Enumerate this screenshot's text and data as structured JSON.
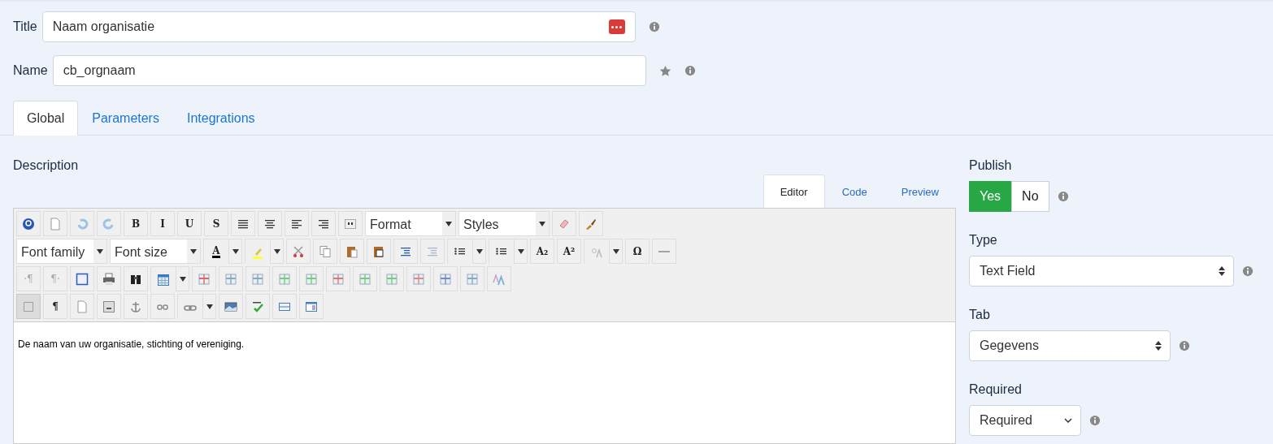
{
  "fields": [
    {
      "label": "Title",
      "value": "Naam organisatie",
      "addon": true,
      "star": false
    },
    {
      "label": "Name",
      "value": "cb_orgnaam",
      "addon": false,
      "star": true
    }
  ],
  "tabs": [
    {
      "label": "Global",
      "selected": true
    },
    {
      "label": "Parameters",
      "selected": false
    },
    {
      "label": "Integrations",
      "selected": false
    }
  ],
  "description": {
    "label": "Description",
    "editor_tabs": [
      {
        "label": "Editor",
        "selected": true
      },
      {
        "label": "Code",
        "selected": false
      },
      {
        "label": "Preview",
        "selected": false
      }
    ],
    "toolbar": [
      [
        {
          "kind": "button",
          "pressed": false
        },
        {
          "kind": "button",
          "pressed": false
        },
        {
          "kind": "button",
          "pressed": false
        },
        {
          "kind": "button",
          "pressed": false
        },
        {
          "kind": "button",
          "label": "B",
          "pressed": false
        },
        {
          "kind": "button",
          "label": "I",
          "pressed": false
        },
        {
          "kind": "button",
          "label": "U",
          "pressed": false
        },
        {
          "kind": "button",
          "label": "S",
          "pressed": false
        },
        {
          "kind": "button",
          "pressed": false
        },
        {
          "kind": "button",
          "pressed": false
        },
        {
          "kind": "button",
          "pressed": false
        },
        {
          "kind": "button",
          "pressed": false
        },
        {
          "kind": "button",
          "pressed": false
        },
        {
          "kind": "select",
          "label": "Format"
        },
        {
          "kind": "select",
          "label": "Styles"
        },
        {
          "kind": "button",
          "pressed": false
        },
        {
          "kind": "button",
          "pressed": false
        }
      ],
      [
        {
          "kind": "select",
          "label": "Font family"
        },
        {
          "kind": "select",
          "label": "Font size"
        },
        {
          "kind": "split",
          "label": "A",
          "pressed": false
        },
        {
          "kind": "split",
          "pressed": false
        },
        {
          "kind": "button",
          "pressed": false
        },
        {
          "kind": "button",
          "pressed": false
        },
        {
          "kind": "button",
          "pressed": false
        },
        {
          "kind": "button",
          "pressed": false
        },
        {
          "kind": "button",
          "pressed": false
        },
        {
          "kind": "button",
          "pressed": false
        },
        {
          "kind": "split",
          "pressed": false
        },
        {
          "kind": "split",
          "pressed": false
        },
        {
          "kind": "button",
          "label": "A₂",
          "pressed": false
        },
        {
          "kind": "button",
          "label": "A²",
          "pressed": false
        },
        {
          "kind": "split",
          "pressed": false
        },
        {
          "kind": "button",
          "label": "Ω",
          "pressed": false
        },
        {
          "kind": "button",
          "pressed": false
        }
      ],
      [
        {
          "kind": "button",
          "label": "·¶",
          "pressed": false
        },
        {
          "kind": "button",
          "label": "¶·",
          "pressed": false
        },
        {
          "kind": "button",
          "pressed": false
        },
        {
          "kind": "button",
          "pressed": false
        },
        {
          "kind": "button",
          "pressed": false
        },
        {
          "kind": "split",
          "pressed": false
        },
        {
          "kind": "button",
          "pressed": false
        },
        {
          "kind": "button",
          "pressed": false
        },
        {
          "kind": "button",
          "pressed": false
        },
        {
          "kind": "button",
          "pressed": false
        },
        {
          "kind": "button",
          "pressed": false
        },
        {
          "kind": "button",
          "pressed": false
        },
        {
          "kind": "button",
          "pressed": false
        },
        {
          "kind": "button",
          "pressed": false
        },
        {
          "kind": "button",
          "pressed": false
        },
        {
          "kind": "button",
          "pressed": false
        },
        {
          "kind": "button",
          "pressed": false
        },
        {
          "kind": "button",
          "pressed": false
        }
      ],
      [
        {
          "kind": "button",
          "pressed": true
        },
        {
          "kind": "button",
          "label": "¶",
          "pressed": false
        },
        {
          "kind": "button",
          "pressed": false
        },
        {
          "kind": "button",
          "pressed": false
        },
        {
          "kind": "button",
          "pressed": false
        },
        {
          "kind": "button",
          "pressed": false
        },
        {
          "kind": "split",
          "pressed": false
        },
        {
          "kind": "button",
          "pressed": false
        },
        {
          "kind": "button",
          "pressed": false
        },
        {
          "kind": "button",
          "pressed": false
        },
        {
          "kind": "button",
          "pressed": false
        }
      ]
    ],
    "content": "De naam van uw organisatie, stichting of vereniging."
  },
  "publish": {
    "label": "Publish",
    "options": [
      {
        "label": "Yes",
        "selected": true
      },
      {
        "label": "No",
        "selected": false
      }
    ]
  },
  "selects": [
    {
      "label": "Type",
      "value": "Text Field"
    },
    {
      "label": "Tab",
      "value": "Gegevens"
    },
    {
      "label": "Required",
      "value": "Required"
    }
  ]
}
